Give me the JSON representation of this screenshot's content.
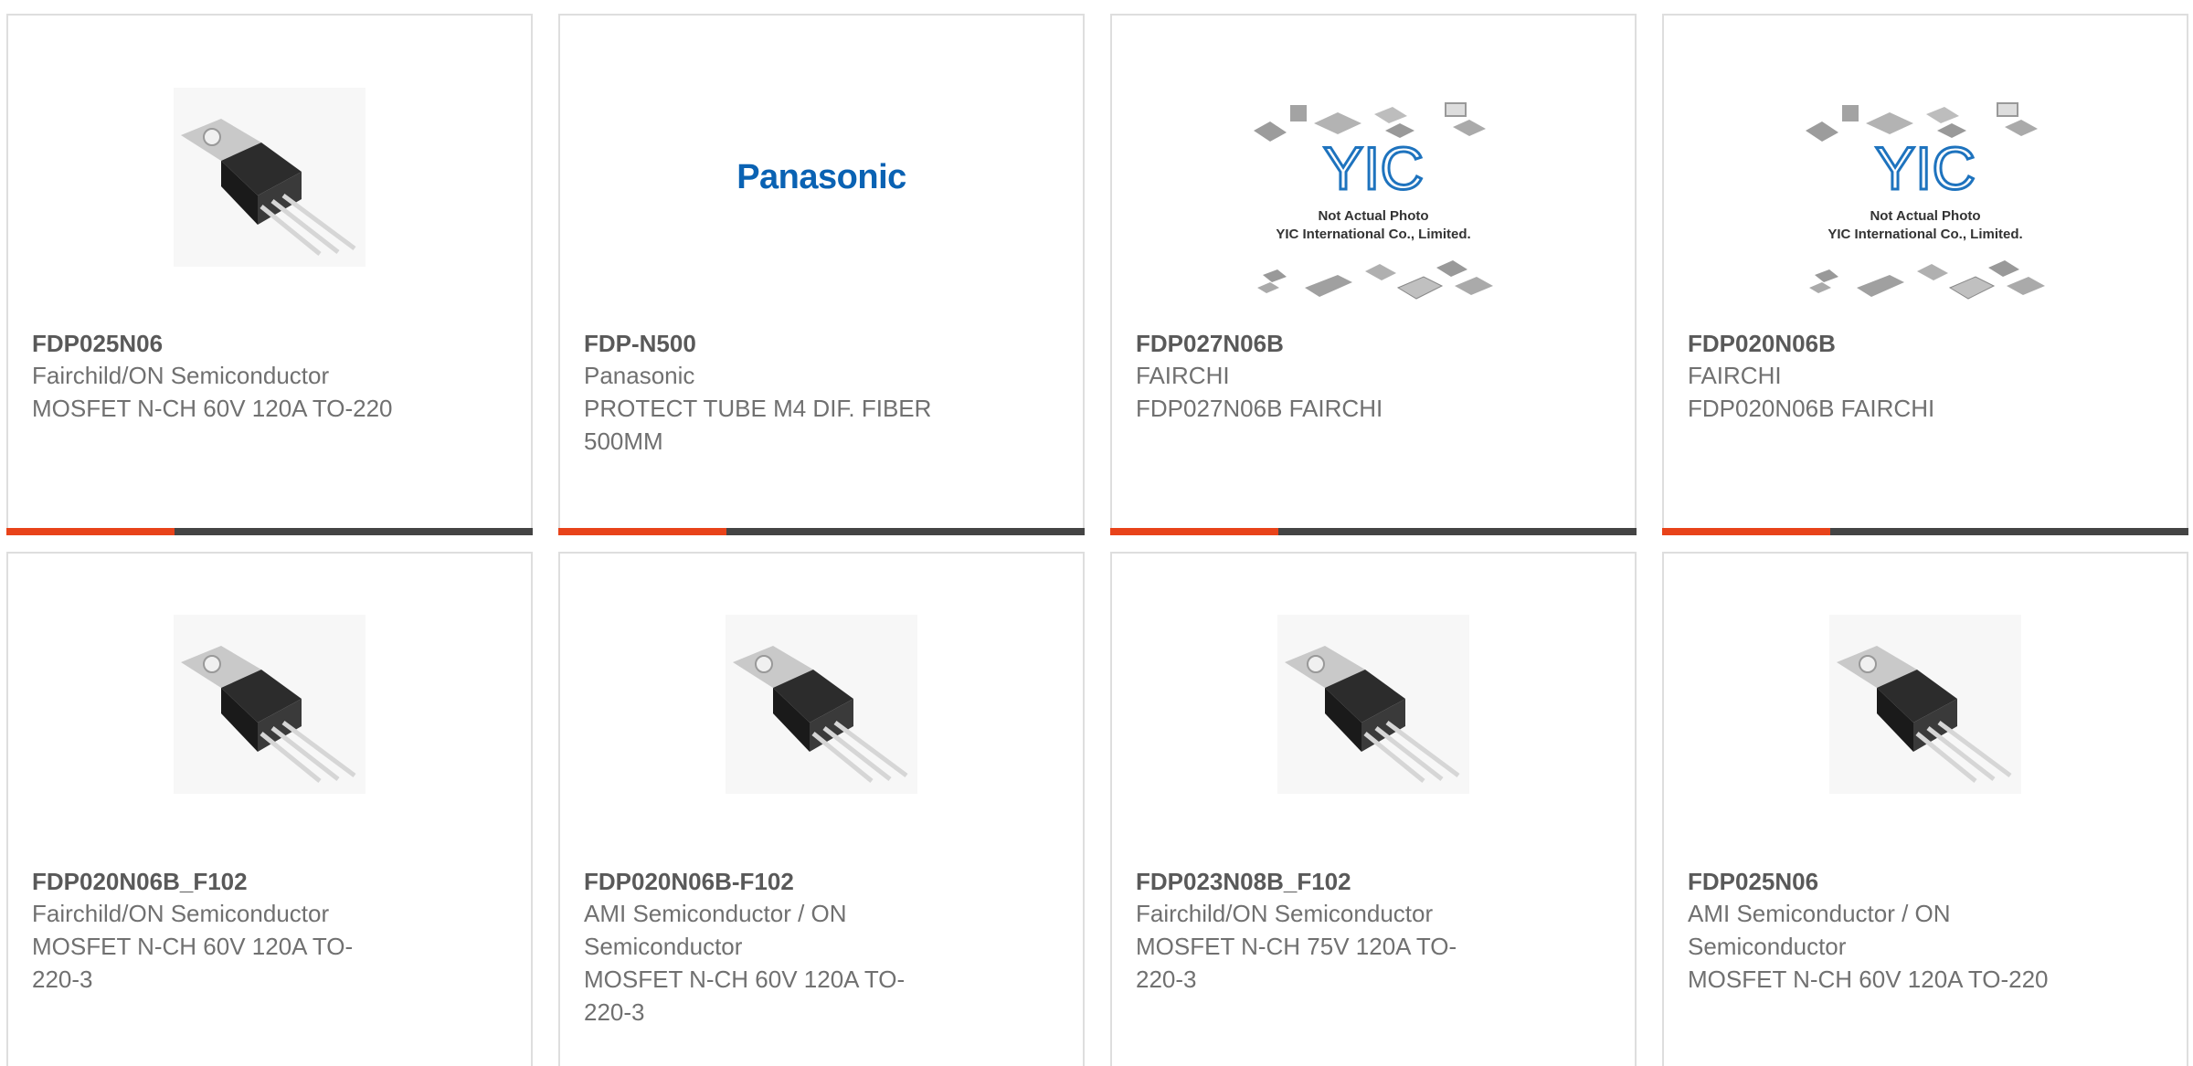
{
  "products": [
    {
      "part": "FDP025N06",
      "maker": "Fairchild/ON Semiconductor",
      "desc": "MOSFET N-CH 60V 120A TO-220",
      "image": "to220-transistor"
    },
    {
      "part": "FDP-N500",
      "maker": "Panasonic",
      "desc": "PROTECT TUBE M4 DIF. FIBER 500MM",
      "image": "panasonic-logo",
      "logo_text": "Panasonic"
    },
    {
      "part": "FDP027N06B",
      "maker": "FAIRCHI",
      "desc": "FDP027N06B FAIRCHI",
      "image": "yic-placeholder",
      "placeholder_lines": [
        "YIC",
        "Not Actual Photo",
        "YIC International Co., Limited."
      ]
    },
    {
      "part": "FDP020N06B",
      "maker": "FAIRCHI",
      "desc": "FDP020N06B FAIRCHI",
      "image": "yic-placeholder",
      "placeholder_lines": [
        "YIC",
        "Not Actual Photo",
        "YIC International Co., Limited."
      ]
    },
    {
      "part": "FDP020N06B_F102",
      "maker": "Fairchild/ON Semiconductor",
      "desc": "MOSFET N-CH 60V 120A TO-220-3",
      "image": "to220-transistor"
    },
    {
      "part": "FDP020N06B-F102",
      "maker": "AMI Semiconductor / ON Semiconductor",
      "desc": "MOSFET N-CH 60V 120A TO-220-3",
      "image": "to220-transistor"
    },
    {
      "part": "FDP023N08B_F102",
      "maker": "Fairchild/ON Semiconductor",
      "desc": "MOSFET N-CH 75V 120A TO-220-3",
      "image": "to220-transistor"
    },
    {
      "part": "FDP025N06",
      "maker": "AMI Semiconductor / ON Semiconductor",
      "desc": "MOSFET N-CH 60V 120A TO-220",
      "image": "to220-transistor"
    }
  ],
  "colors": {
    "accent": "#e8431a",
    "bar": "#444444",
    "panasonic": "#0a62b3",
    "yic": "#1e73be"
  }
}
